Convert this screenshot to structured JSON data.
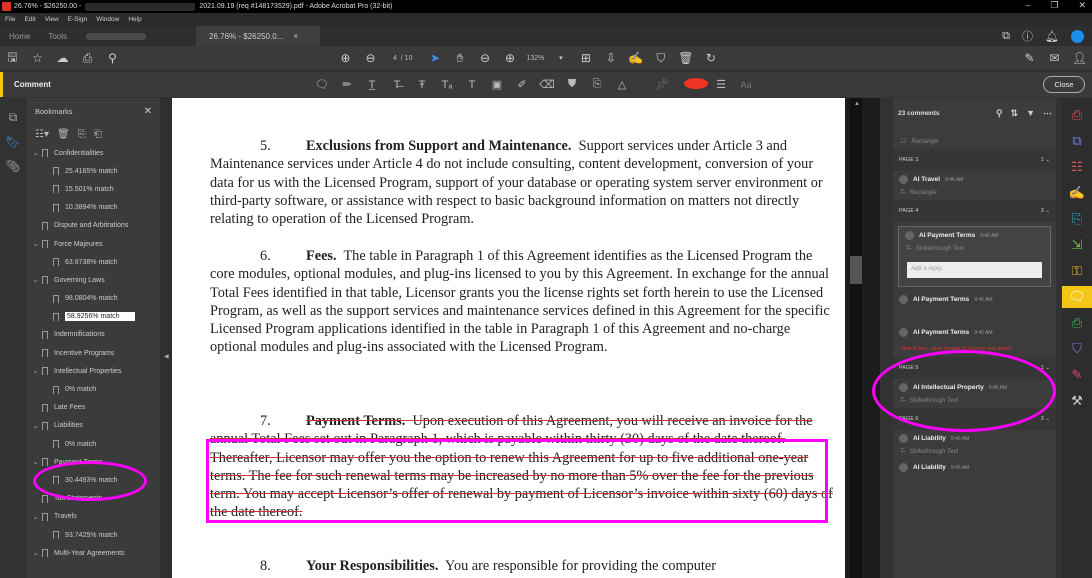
{
  "titlebar": {
    "title_prefix": "26.76% - $26250.00 -",
    "title_suffix": "2021.09.19 (req #148173529).pdf - Adobe Acrobat Pro (32-bit)",
    "minimize": "–",
    "restore": "❐",
    "close": "✕"
  },
  "menu": [
    "File",
    "Edit",
    "View",
    "E-Sign",
    "Window",
    "Help"
  ],
  "tabs": {
    "home": "Home",
    "tools": "Tools",
    "doc_tab": "26.76% - $26250.0...",
    "doc_tab_close": "×"
  },
  "toolbar": {
    "page_current": "4",
    "page_total": "/ 10",
    "zoom": "132%"
  },
  "comment_bar": {
    "label": "Comment",
    "font_label": "Aa",
    "close_label": "Close",
    "color_accent": "#e53322"
  },
  "bookmarks": {
    "title": "Bookmarks",
    "items": [
      {
        "label": "Confidentialities",
        "level": 0,
        "expanded": true
      },
      {
        "label": "25.4165% match",
        "level": 1
      },
      {
        "label": "15.501% match",
        "level": 1
      },
      {
        "label": "10.3894% match",
        "level": 1
      },
      {
        "label": "Dispute and Arbitrations",
        "level": 0
      },
      {
        "label": "Force Majeures",
        "level": 0,
        "expanded": true
      },
      {
        "label": "63.8738% match",
        "level": 1
      },
      {
        "label": "Governing Laws",
        "level": 0,
        "expanded": true
      },
      {
        "label": "98.0804% match",
        "level": 1
      },
      {
        "label": "58.9256% match",
        "level": 1,
        "selected": true
      },
      {
        "label": "Indemnifications",
        "level": 0
      },
      {
        "label": "Incentive Programs",
        "level": 0
      },
      {
        "label": "Intellectual Properties",
        "level": 0,
        "expanded": true
      },
      {
        "label": "0% match",
        "level": 1
      },
      {
        "label": "Late Fees",
        "level": 0
      },
      {
        "label": "Liabilities",
        "level": 0,
        "expanded": true
      },
      {
        "label": "0% match",
        "level": 1
      },
      {
        "label": "Payment Terms",
        "level": 0,
        "expanded": true
      },
      {
        "label": "30.4493% match",
        "level": 1
      },
      {
        "label": "Tax Statements",
        "level": 0
      },
      {
        "label": "Travels",
        "level": 0,
        "expanded": true
      },
      {
        "label": "93.7425% match",
        "level": 1
      },
      {
        "label": "Multi-Year Agreements",
        "level": 0,
        "expanded": true
      }
    ]
  },
  "document": {
    "p5": {
      "num": "5.",
      "heading": "Exclusions from Support and Maintenance.",
      "body": "Support services under Article 3 and Maintenance services under Article 4 do not include consulting, content development, conversion of your data for us with the Licensed Program, support of your database or operating system server environment or third-party software, or assistance with respect to basic background information on matters not directly relating to operation of the Licensed Program."
    },
    "p6": {
      "num": "6.",
      "heading": "Fees.",
      "body": "The table in Paragraph 1 of this Agreement identifies as the Licensed Program the core modules, optional modules, and plug-ins licensed to you by this Agreement.  In exchange for the annual Total Fees identified in that table, Licensor grants you the license rights set forth herein to use the Licensed Program, as well as the support services and maintenance services defined in this Agreement for the specific Licensed Program applications identified in the table in Paragraph 1 of this Agreement and no-charge optional modules and plug-ins associated with the Licensed Program."
    },
    "p7": {
      "num": "7.",
      "heading": "Payment Terms.",
      "body": "Upon execution of this Agreement, you will receive an invoice for the annual Total Fees set out in Paragraph 1, which is payable within thirty (30) days of the date thereof.  Thereafter, Licensor may offer you the option to renew this Agreement for up to five additional one-year terms.  The fee for such renewal terms may be increased by no more than 5% over the fee for the previous term.  You may accept Licensor’s offer of renewal by payment of Licensor’s invoice within sixty (60) days of the date thereof.",
      "strikethrough": true
    },
    "p8": {
      "num": "8.",
      "heading": "Your Responsibilities.",
      "body": "You are responsible for providing the computer"
    }
  },
  "comments": {
    "count_label": "23 comments",
    "items": [
      {
        "type": "sub",
        "text": "Rectangle"
      },
      {
        "type": "page",
        "label": "PAGE 3",
        "count": "1"
      },
      {
        "type": "comment",
        "author": "AI Travel",
        "time": "9:46 AM",
        "sub": "Rectangle"
      },
      {
        "type": "page",
        "label": "PAGE 4",
        "count": "3"
      },
      {
        "type": "comment",
        "author": "AI Payment Terms",
        "time": "9:46 AM",
        "sub": "Strikethrough Text",
        "selected": true,
        "reply_placeholder": "Add a reply..."
      },
      {
        "type": "comment",
        "author": "AI Payment Terms",
        "time": "9:46 AM"
      },
      {
        "type": "comment",
        "author": "AI Payment Terms",
        "time": "9:46 AM",
        "note": "Text in box, upon receipt of invoice and terms",
        "note_color": "#e33333"
      },
      {
        "type": "page",
        "label": "PAGE 5",
        "count": "1"
      },
      {
        "type": "comment",
        "author": "AI Intellectual Property",
        "time": "9:46 AM",
        "sub": "Strikethrough Text"
      },
      {
        "type": "page",
        "label": "PAGE 6",
        "count": "3"
      },
      {
        "type": "comment",
        "author": "AI Liability",
        "time": "9:46 AM",
        "sub": "Strikethrough Text"
      },
      {
        "type": "comment",
        "author": "AI Liability",
        "time": "9:46 AM"
      }
    ]
  },
  "right_rail": [
    {
      "icon": "export-pdf-icon",
      "color": "#e05555"
    },
    {
      "icon": "create-pdf-icon",
      "color": "#6f7ff0"
    },
    {
      "icon": "organize-pages-icon",
      "color": "#e05a5a"
    },
    {
      "icon": "fill-sign-icon",
      "color": "#9a7ef0"
    },
    {
      "icon": "edit-pdf-icon",
      "color": "#2aa6b8"
    },
    {
      "icon": "compress-icon",
      "color": "#6fbf4a"
    },
    {
      "icon": "request-signature-icon",
      "color": "#e8b820"
    },
    {
      "icon": "comment-icon",
      "color": "#ffffff",
      "active": true
    },
    {
      "icon": "print-production-icon",
      "color": "#3fb35a"
    },
    {
      "icon": "protect-icon",
      "color": "#7f72e8"
    },
    {
      "icon": "redact-icon",
      "color": "#e04a6a"
    },
    {
      "icon": "more-tools-icon",
      "color": "#cccccc"
    }
  ]
}
